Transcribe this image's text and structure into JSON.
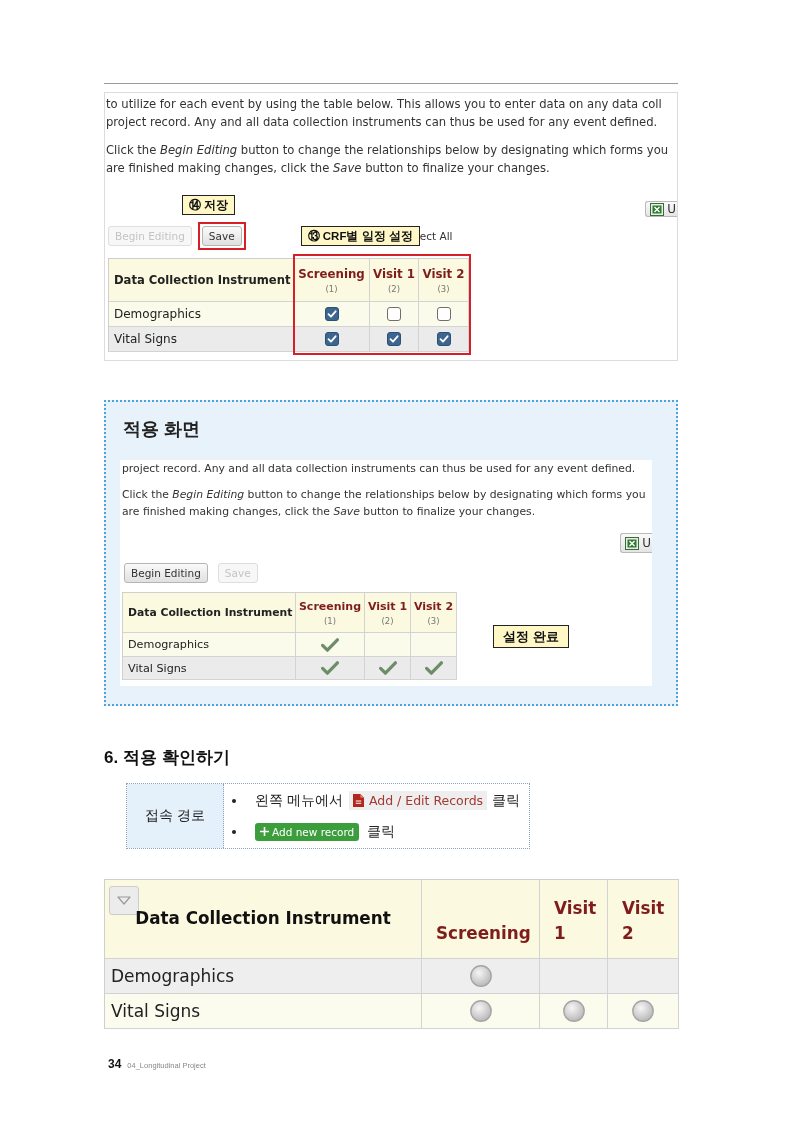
{
  "editor_screenshot": {
    "paragraphs": [
      [
        "to utilize for each event by using the table below. This allows you to enter data on any data coll",
        "project record. Any and all data collection instruments can thus be used for any event defined."
      ],
      [
        "Click the *Begin Editing* button to change the relationships below by designating which forms you",
        "are finished making changes, click the *Save* button to finalize your changes."
      ]
    ],
    "save_callout": "⑭ 저장",
    "export_button": {
      "label": "U"
    },
    "buttons": [
      {
        "label": "Begin Editing",
        "disabled": true,
        "highlighted": false
      },
      {
        "label": "Save",
        "disabled": false,
        "highlighted": true
      }
    ],
    "events_callout": "⑬ CRF별 일정 설정",
    "partial_link": "ect All",
    "table": {
      "instrument_header": "Data Collection Instrument",
      "highlighted": true,
      "events": [
        {
          "name": "Screening",
          "number": "(1)"
        },
        {
          "name": "Visit 1",
          "number": "(2)"
        },
        {
          "name": "Visit 2",
          "number": "(3)"
        }
      ],
      "rows": [
        {
          "name": "Demographics",
          "cells": [
            {
              "checked": true
            },
            {
              "checked": false
            },
            {
              "checked": false
            }
          ]
        },
        {
          "name": "Vital Signs",
          "cells": [
            {
              "checked": true
            },
            {
              "checked": true
            },
            {
              "checked": true
            }
          ]
        }
      ]
    }
  },
  "result_box": {
    "title": "적용 화면",
    "paragraphs": [
      [
        "project record. Any and all data collection instruments can thus be used for any event defined."
      ],
      [
        "Click the *Begin Editing* button to change the relationships below by designating which forms you",
        "are finished making changes, click the *Save* button to finalize your changes."
      ]
    ],
    "export_button": {
      "label": "U"
    },
    "buttons": [
      {
        "label": "Begin Editing",
        "disabled": false
      },
      {
        "label": "Save",
        "disabled": true
      }
    ],
    "table": {
      "instrument_header": "Data Collection Instrument",
      "events": [
        {
          "name": "Screening",
          "number": "(1)"
        },
        {
          "name": "Visit 1",
          "number": "(2)"
        },
        {
          "name": "Visit 2",
          "number": "(3)"
        }
      ],
      "rows": [
        {
          "name": "Demographics",
          "cells": [
            {
              "designated": true
            },
            {
              "designated": false
            },
            {
              "designated": false
            }
          ]
        },
        {
          "name": "Vital Signs",
          "cells": [
            {
              "designated": true
            },
            {
              "designated": true
            },
            {
              "designated": true
            }
          ]
        }
      ]
    },
    "callout": "설정 완료"
  },
  "section": {
    "heading": "6. 적용 확인하기",
    "access_path": {
      "label": "접속 경로",
      "steps": [
        {
          "kind": "menu_link",
          "before": "왼쪽 메뉴에서",
          "link": "Add / Edit Records",
          "after": "클릭"
        },
        {
          "kind": "button",
          "button": "Add new record",
          "after": "클릭"
        }
      ]
    }
  },
  "record_table": {
    "instrument_header": "Data Collection Instrument",
    "events": [
      "Screening",
      "Visit 1",
      "Visit 2"
    ],
    "rows": [
      {
        "name": "Demographics",
        "cells": [
          {
            "designated": true
          },
          {
            "designated": false
          },
          {
            "designated": false
          }
        ]
      },
      {
        "name": "Vital Signs",
        "cells": [
          {
            "designated": true
          },
          {
            "designated": true
          },
          {
            "designated": true
          }
        ]
      }
    ]
  },
  "footer": {
    "page_number": "34",
    "chapter": "04_Longitudinal Project"
  }
}
